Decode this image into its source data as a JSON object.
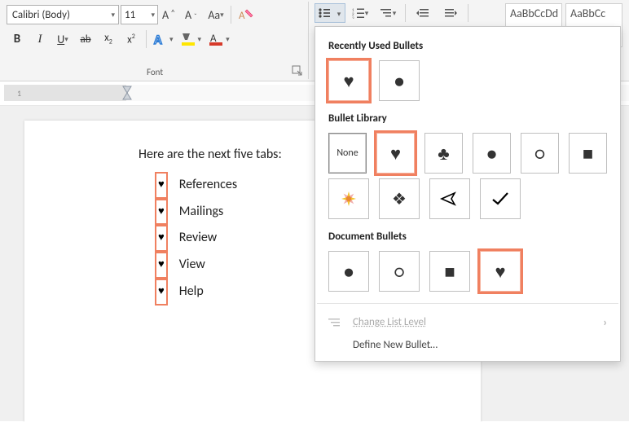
{
  "ribbon": {
    "font_group_label": "Font",
    "font_name": "Calibri (Body)",
    "font_size": "11",
    "style_preview_1": "AaBbCcDd",
    "style_preview_2": "AaBbCc"
  },
  "ruler": {
    "mark1": "1"
  },
  "document": {
    "intro": "Here are the next five tabs:",
    "items": {
      "0": "References",
      "1": "Mailings",
      "2": "Review",
      "3": "View",
      "4": "Help"
    },
    "bullet_glyph": "♥"
  },
  "dropdown": {
    "section_recent": "Recently Used Bullets",
    "section_library": "Bullet Library",
    "section_document": "Document Bullets",
    "none_label": "None",
    "change_list_level": "Change List Level",
    "define_new": "Define New Bullet…",
    "recent": {
      "0": "♥",
      "1": "●"
    },
    "library": {
      "0": "None",
      "1": "♥",
      "2": "♣",
      "3": "●",
      "4": "○",
      "5": "■",
      "6": "✦",
      "7": "❖",
      "8": "➤",
      "9": "✓"
    },
    "docbullets": {
      "0": "●",
      "1": "○",
      "2": "■",
      "3": "♥"
    }
  }
}
